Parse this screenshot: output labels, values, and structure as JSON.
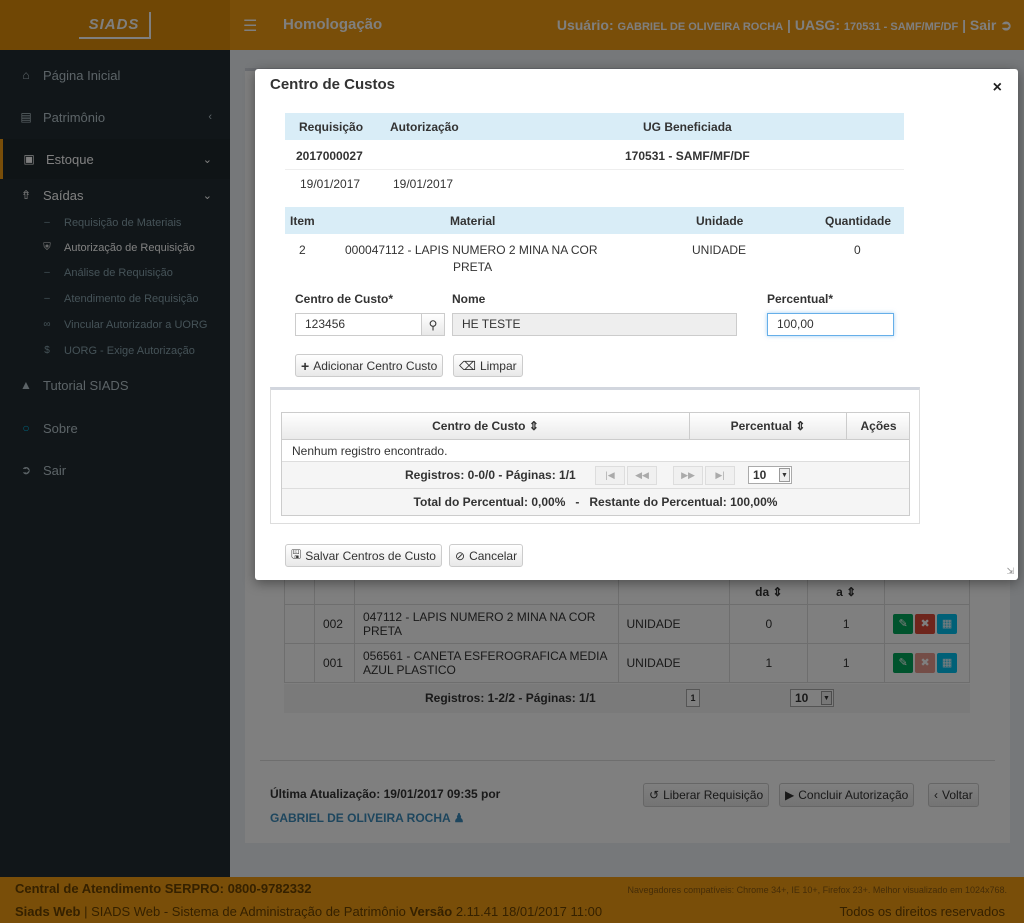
{
  "header": {
    "logo": "SIADS",
    "menu_icon": "hamburger-icon",
    "environment": "Homologação",
    "user_label": "Usuário:",
    "user_name": "GABRIEL DE OLIVEIRA ROCHA",
    "uasg_label": "UASG:",
    "uasg_value": "170531 - SAMF/MF/DF",
    "logout": "Sair"
  },
  "sidebar": {
    "items": [
      {
        "label": "Página Inicial",
        "icon": "home-icon"
      },
      {
        "label": "Patrimônio",
        "icon": "columns-icon"
      },
      {
        "label": "Estoque",
        "icon": "box-icon"
      },
      {
        "label": "Saídas",
        "icon": "upload-icon"
      },
      {
        "label": "Tutorial SIADS",
        "icon": "graduation-cap-icon"
      },
      {
        "label": "Sobre",
        "icon": "circle-icon"
      },
      {
        "label": "Sair",
        "icon": "sign-in-icon"
      }
    ],
    "subitems": [
      {
        "label": "Requisição de Materiais",
        "icon": "dash-icon"
      },
      {
        "label": "Autorização de Requisição",
        "icon": "shield-icon"
      },
      {
        "label": "Análise de Requisição",
        "icon": "dash-icon"
      },
      {
        "label": "Atendimento de Requisição",
        "icon": "dash-icon"
      },
      {
        "label": "Vincular Autorizador a UORG",
        "icon": "link-icon"
      },
      {
        "label": "UORG - Exige Autorização",
        "icon": "dollar-icon"
      }
    ]
  },
  "background": {
    "rows": [
      {
        "seq": "002",
        "material": "047112 - LAPIS NUMERO 2 MINA NA COR PRETA",
        "unidade": "UNIDADE",
        "qtd1": "0",
        "qtd2": "1"
      },
      {
        "seq": "001",
        "material": "056561 - CANETA ESFEROGRAFICA MEDIA AZUL PLASTICO",
        "unidade": "UNIDADE",
        "qtd1": "1",
        "qtd2": "1"
      }
    ],
    "col_da": "da",
    "col_a": "a",
    "registros": "Registros: 1-2/2 - Páginas: 1/1",
    "page": "1",
    "per_page": "10",
    "ultima_atualizacao": "Última Atualização: 19/01/2017 09:35 por",
    "ultima_user": "GABRIEL DE OLIVEIRA ROCHA",
    "btn_liberar": "Liberar Requisição",
    "btn_concluir": "Concluir Autorização",
    "btn_voltar": "Voltar"
  },
  "modal": {
    "title": "Centro de Custos",
    "close": "×",
    "req_headers": {
      "requisicao": "Requisição",
      "autorizacao": "Autorização",
      "ug": "UG Beneficiada"
    },
    "req": {
      "numero": "2017000027",
      "ug": "170531 - SAMF/MF/DF",
      "data_req": "19/01/2017",
      "data_aut": "19/01/2017"
    },
    "item_headers": {
      "item": "Item",
      "material": "Material",
      "unidade": "Unidade",
      "quantidade": "Quantidade"
    },
    "item": {
      "item": "2",
      "material_l1": "000047112 - LAPIS NUMERO 2 MINA NA COR",
      "material_l2": "PRETA",
      "unidade": "UNIDADE",
      "quantidade": "0"
    },
    "form": {
      "centro_label": "Centro de Custo*",
      "centro_value": "123456",
      "nome_label": "Nome",
      "nome_value": "HE TESTE",
      "perc_label": "Percentual*",
      "perc_value": "100,00"
    },
    "btn_adicionar": "Adicionar Centro Custo",
    "btn_limpar": "Limpar",
    "table": {
      "col_centro": "Centro de Custo",
      "col_percentual": "Percentual",
      "col_acoes": "Ações",
      "empty": "Nenhum registro encontrado.",
      "registros": "Registros: 0-0/0 - Páginas: 1/1",
      "per_page": "10",
      "total": "Total do Percentual: 0,00%   -   Restante do Percentual: 100,00%"
    },
    "btn_salvar": "Salvar Centros de Custo",
    "btn_cancelar": "Cancelar"
  },
  "footer": {
    "central": "Central de Atendimento SERPRO: 0800-9782332",
    "browsers": "Navegadores compatíveis: Chrome 34+, IE 10+, Firefox 23+. Melhor visualizado em 1024x768.",
    "app": "Siads Web",
    "app_desc": "| SIADS Web - Sistema de Administração de Patrimônio",
    "versao_label": "Versão",
    "versao": "2.11.41 18/01/2017 11:00",
    "direitos": "Todos os direitos reservados"
  }
}
